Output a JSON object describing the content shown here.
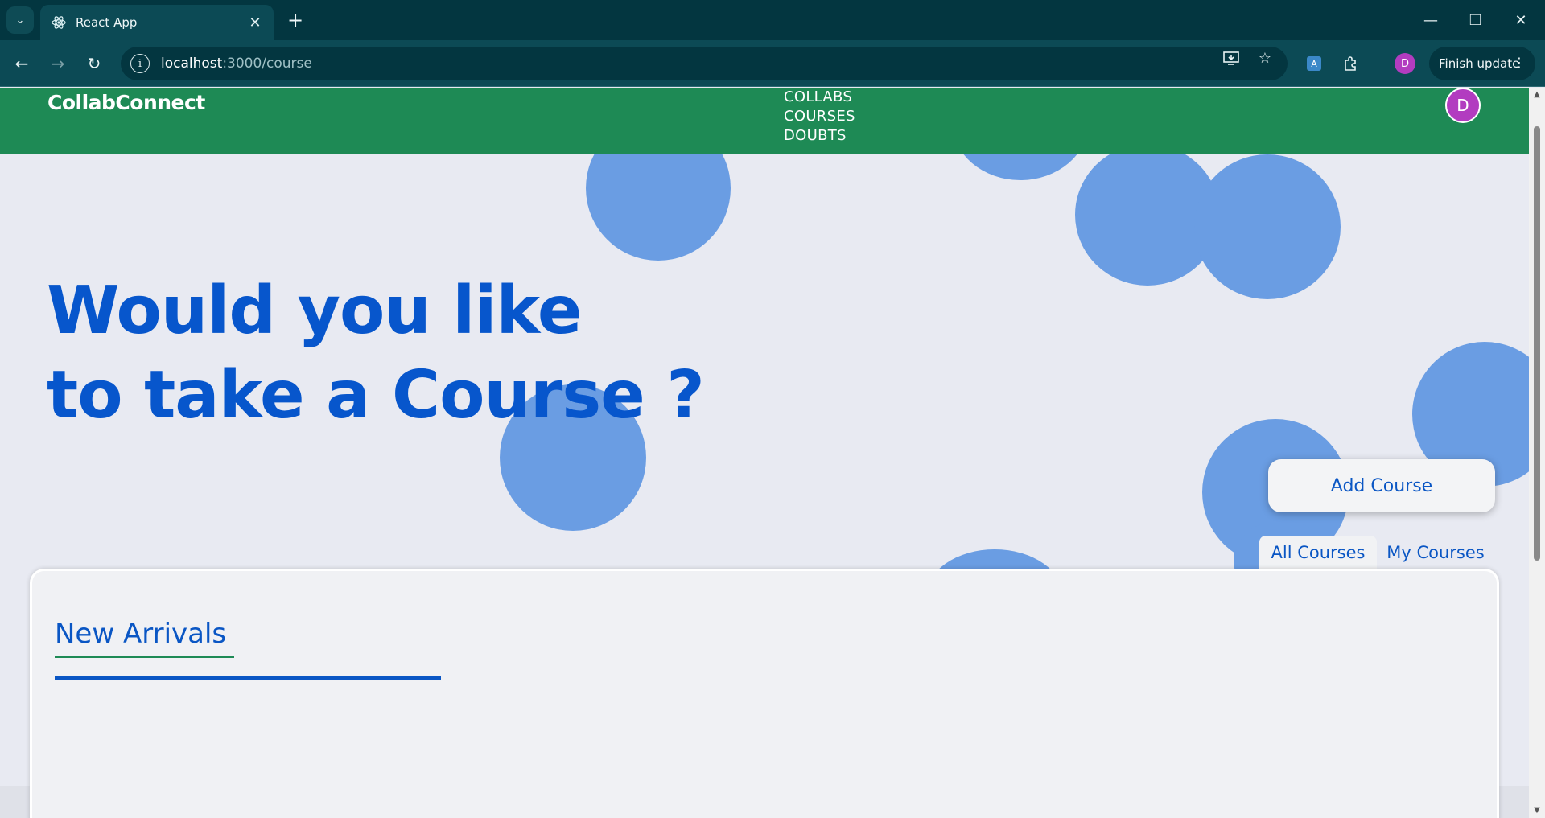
{
  "browser": {
    "tab_search_icon": "chevron-down-icon",
    "tab_title": "React App",
    "tab_favicon": "react-icon",
    "new_tab_symbol": "+",
    "url_host": "localhost",
    "url_path": ":3000/course",
    "finish_update_label": "Finish update",
    "profile_initial": "D"
  },
  "app": {
    "brand": "CollabConnect",
    "nav": [
      "COLLABS",
      "COURSES",
      "DOUBTS"
    ],
    "avatar_initial": "D",
    "hero_line1": "Would you like",
    "hero_line2": "to take a Course ?",
    "add_course_label": "Add Course",
    "tabs": {
      "all": "All Courses",
      "mine": "My Courses",
      "active": "All Courses"
    },
    "section_title": "New Arrivals"
  },
  "colors": {
    "appbar": "#1e8a55",
    "accent_blue": "#0756cc",
    "bubble": "#6a9de3",
    "avatar": "#b23cc0"
  }
}
